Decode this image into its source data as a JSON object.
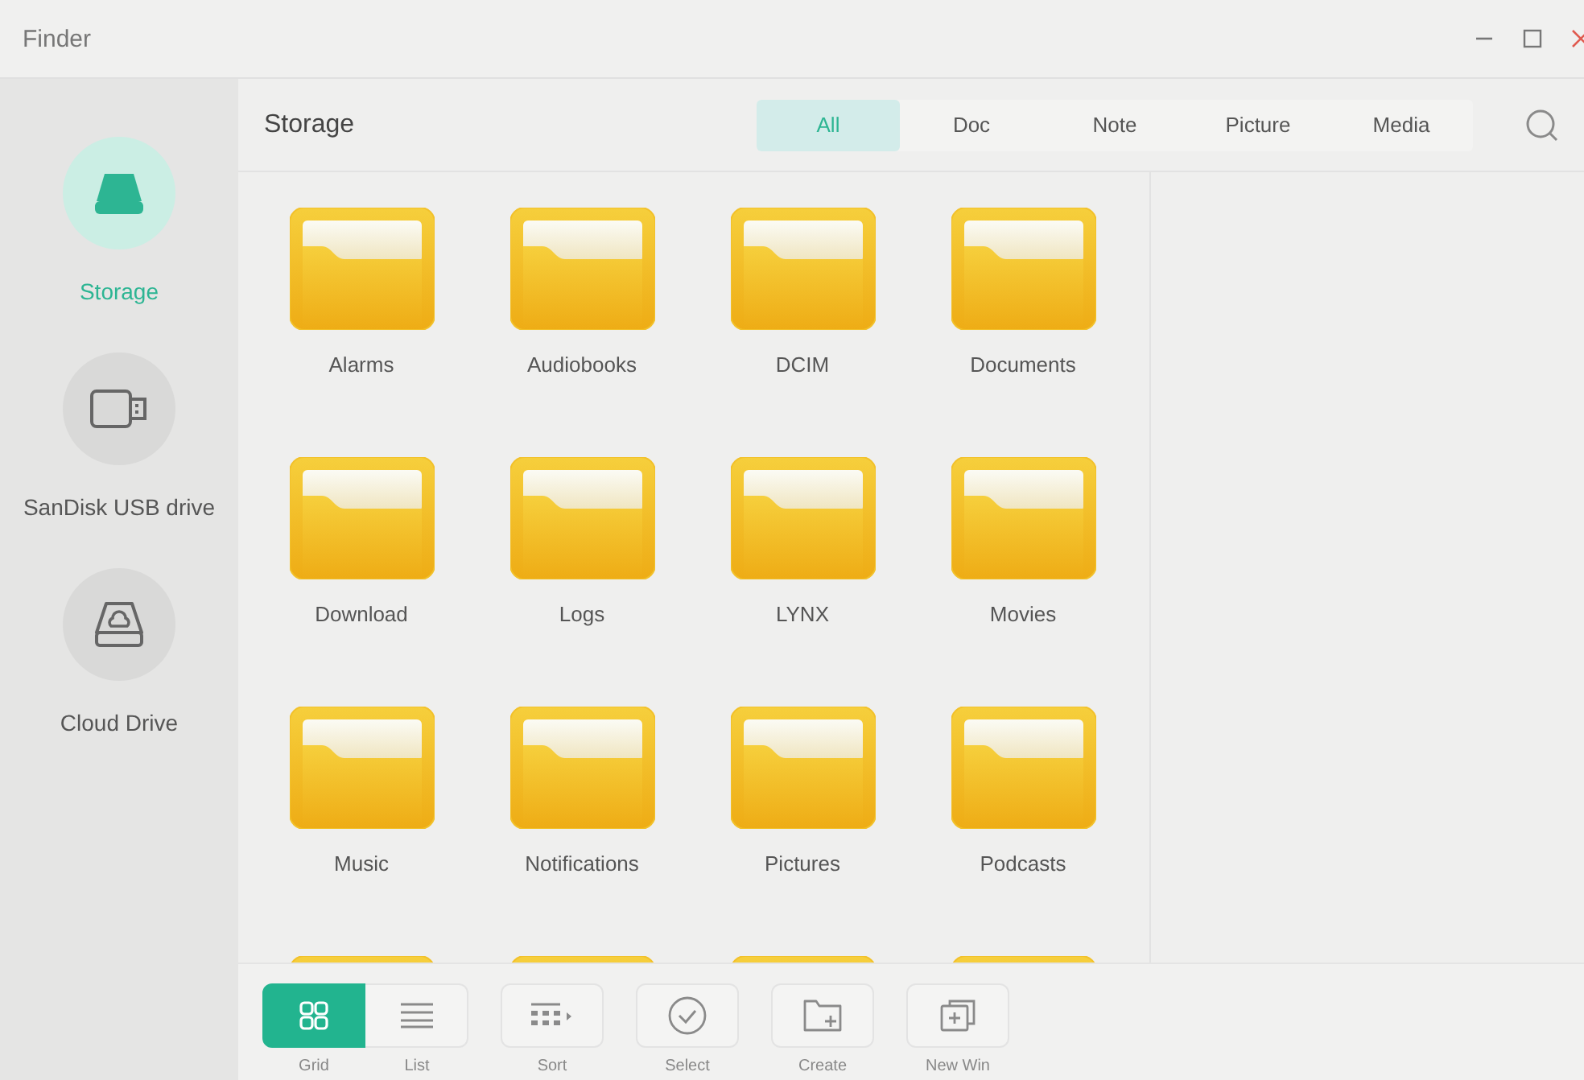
{
  "window": {
    "title": "Finder"
  },
  "sidebar": {
    "items": [
      {
        "label": "Storage",
        "kind": "storage",
        "selected": true
      },
      {
        "label": "SanDisk USB drive",
        "kind": "usb",
        "selected": false
      },
      {
        "label": "Cloud Drive",
        "kind": "cloud",
        "selected": false
      }
    ]
  },
  "header": {
    "title": "Storage"
  },
  "tabs": [
    {
      "label": "All",
      "selected": true
    },
    {
      "label": "Doc",
      "selected": false
    },
    {
      "label": "Note",
      "selected": false
    },
    {
      "label": "Picture",
      "selected": false
    },
    {
      "label": "Media",
      "selected": false
    }
  ],
  "folders": [
    {
      "kind": "folder",
      "name": "Alarms"
    },
    {
      "kind": "folder",
      "name": "Audiobooks"
    },
    {
      "kind": "folder",
      "name": "DCIM"
    },
    {
      "kind": "folder",
      "name": "Documents"
    },
    {
      "kind": "folder",
      "name": "Download"
    },
    {
      "kind": "folder",
      "name": "Logs"
    },
    {
      "kind": "folder",
      "name": "LYNX"
    },
    {
      "kind": "folder",
      "name": "Movies"
    },
    {
      "kind": "folder",
      "name": "Music"
    },
    {
      "kind": "folder",
      "name": "Notifications"
    },
    {
      "kind": "folder",
      "name": "Pictures"
    },
    {
      "kind": "folder",
      "name": "Podcasts"
    },
    {
      "kind": "folder-partial"
    },
    {
      "kind": "folder-partial"
    },
    {
      "kind": "folder-partial"
    },
    {
      "kind": "folder-partial"
    }
  ],
  "toolbar": [
    {
      "kind": "grid",
      "label": "Grid",
      "selected": true
    },
    {
      "kind": "list",
      "label": "List",
      "selected": false
    },
    {
      "kind": "sort",
      "label": "Sort"
    },
    {
      "kind": "select",
      "label": "Select"
    },
    {
      "kind": "create",
      "label": "Create"
    },
    {
      "kind": "newwin",
      "label": "New Win"
    }
  ]
}
